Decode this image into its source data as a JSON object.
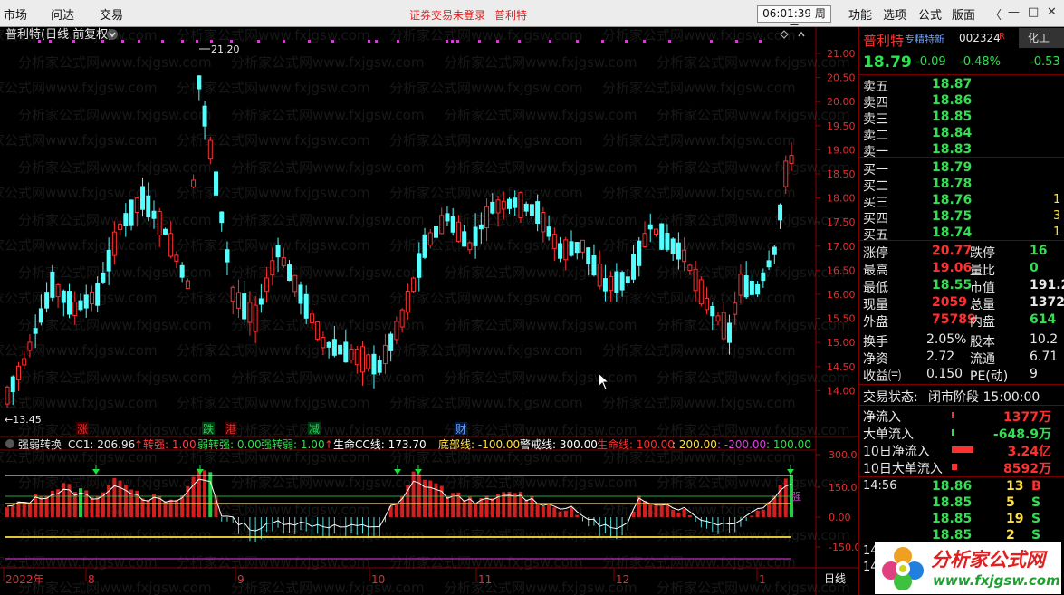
{
  "topbar": {
    "menu_market": "市场",
    "menu_wenda": "问达",
    "menu_trade": "交易",
    "login_status": "证券交易未登录",
    "stock_name": "普利特",
    "clock": "06:01:39 周三",
    "menu_func": "功能",
    "menu_option": "选项",
    "menu_formula": "公式",
    "menu_layout": "版面",
    "win_back": "〈",
    "win_min": "—",
    "win_max": "□",
    "win_close": "✕"
  },
  "main_chart": {
    "title": "普利特(日线 前复权)",
    "high_label": "21.20",
    "low_label": "←13.45",
    "y_ticks": [
      "21.00",
      "20.50",
      "20.00",
      "19.50",
      "19.00",
      "18.50",
      "18.00",
      "17.50",
      "17.00",
      "16.50",
      "16.00",
      "15.50",
      "15.00",
      "14.50",
      "14.00"
    ],
    "markers": [
      {
        "text": "涨",
        "color": "#e03030",
        "bg": "#3a0000"
      },
      {
        "text": "跌",
        "color": "#30d060",
        "bg": "#003a10"
      },
      {
        "text": "港",
        "color": "#e03030",
        "bg": "#3a0000"
      },
      {
        "text": "减",
        "color": "#30d060",
        "bg": "#003a10"
      },
      {
        "text": "财",
        "color": "#6aa0ff",
        "bg": "#001a40"
      }
    ]
  },
  "indicator": {
    "name": "强弱转换",
    "cc1": "CC1: 206.96",
    "zhuanqiang": "转强: 1.00",
    "ruozhuanqiang": "弱转强: 0.00",
    "qiangzhuanruo": "强转弱: 1.00",
    "shengming_cc": "生命CC线: 173.70",
    "dibu": "底部线: -100.00",
    "jingjie": "警戒线: 300.00",
    "shengming": "生命线: 100.00",
    "v200": ": 200.00",
    "vneg200": ": -200.00",
    "v100": ": 100.00",
    "y_ticks": [
      "300.0",
      "150.0",
      "0.00",
      "-150.0"
    ],
    "label_qiang": "强"
  },
  "timeline": {
    "labels": [
      "2022年",
      "8",
      "9",
      "10",
      "11",
      "12",
      "1"
    ],
    "period": "日线"
  },
  "quote": {
    "name": "普利特",
    "tag": "专精特新",
    "code": "002324",
    "flag": "R",
    "sector": "化工",
    "price": "18.79",
    "change": "-0.09",
    "change_pct": "-0.48%",
    "sector_change": "-0.53",
    "asks": [
      {
        "label": "卖五",
        "price": "18.87"
      },
      {
        "label": "卖四",
        "price": "18.86"
      },
      {
        "label": "卖三",
        "price": "18.85"
      },
      {
        "label": "卖二",
        "price": "18.84"
      },
      {
        "label": "卖一",
        "price": "18.83"
      }
    ],
    "bids": [
      {
        "label": "买一",
        "price": "18.79"
      },
      {
        "label": "买二",
        "price": "18.78"
      },
      {
        "label": "买三",
        "price": "18.76",
        "extra": "1"
      },
      {
        "label": "买四",
        "price": "18.75",
        "extra": "3"
      },
      {
        "label": "买五",
        "price": "18.74",
        "extra": "1"
      }
    ],
    "stats": [
      {
        "l1": "涨停",
        "v1": "20.77",
        "c1": "#ff3030",
        "l2": "跌停",
        "v2": "16",
        "c2": "#30e050"
      },
      {
        "l1": "最高",
        "v1": "19.06",
        "c1": "#ff3030",
        "l2": "量比",
        "v2": "0",
        "c2": "#30e050"
      },
      {
        "l1": "最低",
        "v1": "18.55",
        "c1": "#30e050",
        "l2": "市值",
        "v2": "191.2",
        "c2": "#e8e8e8"
      },
      {
        "l1": "现量",
        "v1": "2059",
        "c1": "#ff3030",
        "l2": "总量",
        "v2": "1372",
        "c2": "#e8e8e8"
      },
      {
        "l1": "外盘",
        "v1": "75789",
        "c1": "#ff3030",
        "l2": "内盘",
        "v2": "614",
        "c2": "#30e050"
      }
    ],
    "stats2": [
      {
        "l1": "换手",
        "v1": "2.05%",
        "l2": "股本",
        "v2": "10.2"
      },
      {
        "l1": "净资",
        "v1": "2.72",
        "l2": "流通",
        "v2": "6.71"
      },
      {
        "l1": "收益㈢",
        "v1": "0.150",
        "l2": "PE(动)",
        "v2": "9"
      }
    ],
    "trade_status_label": "交易状态:",
    "trade_status": "闭市阶段 15:00:00",
    "flows": [
      {
        "label": "净流入",
        "value": "1377万"
      },
      {
        "label": "大单流入",
        "value": "-648.9万"
      },
      {
        "label": "10日净流入",
        "value": "3.24亿"
      },
      {
        "label": "10日大单流入",
        "value": "8592万"
      }
    ],
    "ticks": [
      {
        "time": "14:56",
        "price": "18.86",
        "vol": "13",
        "side": "B"
      },
      {
        "time": "",
        "price": "18.85",
        "vol": "5",
        "side": "S"
      },
      {
        "time": "",
        "price": "18.85",
        "vol": "19",
        "side": "S"
      },
      {
        "time": "",
        "price": "18.85",
        "vol": "2",
        "side": "S"
      },
      {
        "time": "14",
        "price": "",
        "vol": "",
        "side": ""
      },
      {
        "time": "14",
        "price": "",
        "vol": "",
        "side": ""
      }
    ]
  },
  "watermark": {
    "text": "分析家公式网www.fxjgsw.com"
  },
  "logo": {
    "cn": "分析家公式网",
    "url": "www.fxjgsw.com"
  }
}
